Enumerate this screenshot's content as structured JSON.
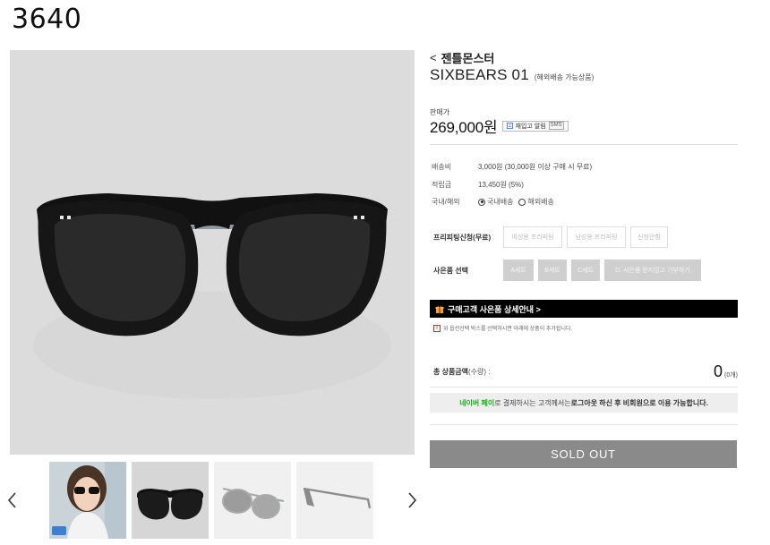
{
  "page": {
    "id_label": "3640"
  },
  "product": {
    "brand_link": "젠틀몬스터",
    "name": "SIXBEARS 01",
    "name_note": "(해외배송 가능상품)",
    "price_label": "판매가",
    "price": "269,000원",
    "restock_label": "재입고 알림",
    "restock_sms": "SMS"
  },
  "specs": [
    {
      "key": "배송비",
      "value": "3,000원 (30,000원 이상 구매 시 무료)"
    },
    {
      "key": "적립금",
      "value": "13,450원 (5%)"
    },
    {
      "key": "국내/해외",
      "options": [
        "국내배송",
        "해외배송"
      ],
      "selected": "국내배송"
    }
  ],
  "options": {
    "fitting_label": "프리피팅신청(무료)",
    "fitting_buttons": [
      "여성용 프리피팅",
      "남성용 프리피팅",
      "신청안함"
    ],
    "gift_label": "사은품 선택",
    "gift_buttons": [
      "A세트",
      "B세트",
      "C세트",
      "D. 사은품 받지않고 기부하기"
    ]
  },
  "gift_banner": "구매고객 사은품 상세안내 >",
  "notice": "위 옵션선택 박스를 선택하시면 아래에 상품이 추가됩니다.",
  "total": {
    "label": "총 상품금액",
    "qty_label": "(수량) :",
    "value": "0",
    "count": "(0개)"
  },
  "naver_notice": {
    "brand": "네이버 페이",
    "text1": "로 결제하시는 고객께서는 ",
    "bold": "로그아웃 하신 후 비회원으로 이용 가능합니다."
  },
  "buy_button": "SOLD OUT",
  "thumbnails": [
    "model-photo",
    "front-view",
    "angle-view",
    "side-view"
  ],
  "colors": {
    "banner_bg": "#000000",
    "sold_out_bg": "#8a8a8a",
    "naver_green": "#19b119",
    "image_bg": "#dcdcdc"
  }
}
